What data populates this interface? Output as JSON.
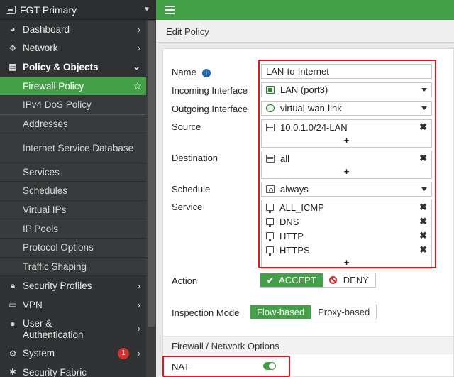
{
  "sidebar": {
    "device_name": "FGT-Primary",
    "items": [
      {
        "label": "Dashboard",
        "icon": "gauge-icon"
      },
      {
        "label": "Network",
        "icon": "network-icon"
      },
      {
        "label": "Policy & Objects",
        "icon": "policy-icon"
      }
    ],
    "subitems": [
      {
        "label": "Firewall Policy"
      },
      {
        "label": "IPv4 DoS Policy"
      },
      {
        "label": "Addresses"
      },
      {
        "label": "Internet Service Database"
      },
      {
        "label": "Services"
      },
      {
        "label": "Schedules"
      },
      {
        "label": "Virtual IPs"
      },
      {
        "label": "IP Pools"
      },
      {
        "label": "Protocol Options"
      },
      {
        "label": "Traffic Shaping"
      }
    ],
    "lower_items": [
      {
        "label": "Security Profiles",
        "icon": "lock-icon"
      },
      {
        "label": "VPN",
        "icon": "monitor-icon"
      },
      {
        "label": "User & Authentication",
        "icon": "user-icon"
      },
      {
        "label": "System",
        "icon": "gear-icon",
        "badge": "1"
      },
      {
        "label": "Security Fabric",
        "icon": "fabric-icon"
      }
    ]
  },
  "page": {
    "title": "Edit Policy"
  },
  "form": {
    "name_label": "Name",
    "name_value": "LAN-to-Internet",
    "incoming_label": "Incoming Interface",
    "incoming_value": "LAN (port3)",
    "outgoing_label": "Outgoing Interface",
    "outgoing_value": "virtual-wan-link",
    "source_label": "Source",
    "source_values": [
      "10.0.1.0/24-LAN"
    ],
    "destination_label": "Destination",
    "destination_values": [
      "all"
    ],
    "schedule_label": "Schedule",
    "schedule_value": "always",
    "service_label": "Service",
    "service_values": [
      "ALL_ICMP",
      "DNS",
      "HTTP",
      "HTTPS"
    ],
    "plus": "+",
    "remove": "✖",
    "action_label": "Action",
    "action_options": [
      "ACCEPT",
      "DENY"
    ],
    "action_selected": "ACCEPT",
    "inspection_label": "Inspection Mode",
    "inspection_options": [
      "Flow-based",
      "Proxy-based"
    ],
    "inspection_selected": "Flow-based",
    "section_title": "Firewall / Network Options",
    "nat_label": "NAT",
    "nat_enabled": true
  },
  "colors": {
    "accent": "#43a047",
    "highlight": "#e0141b",
    "sidebar": "#2f3133"
  }
}
